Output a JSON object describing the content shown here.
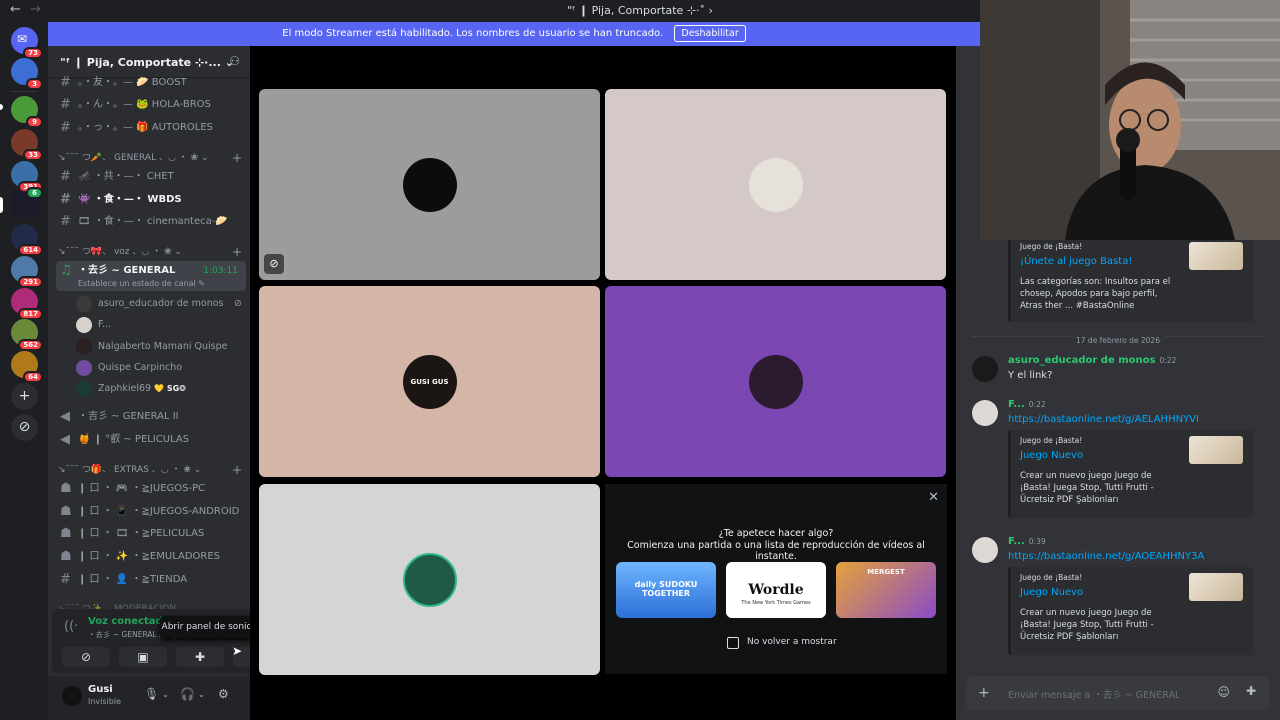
{
  "window": {
    "title": "\"ᶠ ❙ Pija, Comportate ⊹·˚ ›",
    "back": "←",
    "forward": "→"
  },
  "banner": {
    "text": "El modo Streamer está habilitado. Los nombres de usuario se han truncado.",
    "button": "Deshabilitar",
    "color": "#5865f2"
  },
  "server_rail": {
    "badges": [
      "73",
      "3",
      "9",
      "33",
      "391",
      "6",
      "614",
      "291",
      "817",
      "562",
      "64"
    ],
    "add_icon": "plus-icon",
    "discover_icon": "compass-icon"
  },
  "guild": {
    "name": "\"ᶠ ❙ Pija, Comportate ⊹·...",
    "chevron": "⌄"
  },
  "channels": {
    "boost": "。・友・。— 🥟 BOOST",
    "hola_bros": "。・ん・。— 🐸 HOLA-BROS",
    "autoroles": "。・っ・。— 🎁 AUTOROLES",
    "cat_general": "↘˘˘˘ つ🥕、 GENERAL 、◡ ・ ❀ ⌄",
    "chet": "🦟 ・共・—・ CHET",
    "wbds": "👾 ・食・—・ WBDS",
    "cinemanteca": "🎞 ・食・—・ cinemanteca-🥟",
    "cat_voz": "↘˘˘˘ つ🎀、 voz 、◡ ・ ❀ ⌄",
    "voice_general": "・去彡 ~ GENERAL",
    "voice_timer": "1:03:11",
    "voice_status_hint": "Establece un estado de canal ✎",
    "general_ii": "・吉彡 ~ GENERAL II",
    "peliculas": "🍯 ❙ °叡 ~ PELICULAS",
    "cat_extras": "↘˘˘˘ つ🎁、 EXTRAS 、◡ ・ ❀ ⌄",
    "juegos_pc": "❙ 口 ・ 🎮 ・≧JUEGOS-PC",
    "juegos_android": "❙ 口 ・ 📱 ・≧JUEGOS-ANDROID",
    "peliculas2": "❙ 口 ・ 🎞 ・≧PELICULAS",
    "emuladores": "❙ 口 ・ ✨ ・≧EMULADORES",
    "tienda": "❙ 口 ・ 👤 ・≧TIENDA",
    "cat_moderation": "↘˘˘˘ つ✨、 MODERACION"
  },
  "voice_members": [
    {
      "name": "asuro_educador de monos",
      "color": "#3a3a3a"
    },
    {
      "name": "F...",
      "color": "#d8d3cf"
    },
    {
      "name": "Nalgaberto Mamani Quispe",
      "color": "#2b2020"
    },
    {
      "name": "Quispe Carpincho",
      "color": "#6f4da1"
    },
    {
      "name": "Zaphkiel69",
      "color": "#1d3b36",
      "tag": "💛 SG❂"
    }
  ],
  "voice_panel": {
    "connected": "Voz conectada",
    "location": "・去彡 ~ GENERAL / \"ᶠ ❙ Pija, Comportate",
    "tooltip": "Abrir panel de sonidos"
  },
  "user": {
    "name": "Gusi",
    "status": "Invisible"
  },
  "stage": {
    "tiles": [
      {
        "bg": "#9c9c9c",
        "avatar": "#0c0c0c"
      },
      {
        "bg": "#d4c9c6",
        "avatar": "#e7e1dc"
      },
      {
        "bg": "#d4b5a7",
        "avatar": "#1b1613"
      },
      {
        "bg": "#7a47b3",
        "avatar": "#2c1a2e"
      },
      {
        "bg": "#d5d5d5",
        "avatar": "#1f5a48"
      }
    ],
    "gusi_logo": "GUSI GUS"
  },
  "activity": {
    "title": "¿Te apetece hacer algo?",
    "subtitle": "Comienza una partida o una lista de reproducción de vídeos al instante.",
    "games": [
      "daily SUDOKU TOGETHER",
      "Wordle",
      "MERGEST"
    ],
    "wordle_sub": "The New York Times Games",
    "checkbox": "No volver a mostrar"
  },
  "chat": {
    "embed1": {
      "provider": "Juego de ¡Basta!",
      "title": "¡Únete al juego Basta!",
      "desc": "Las categorías son: Insultos para el chosep, Apodos para bajo perfil, Atras ther ... #BastaOnline"
    },
    "date": "17 de febrero de 2026",
    "msg1": {
      "name": "asuro_educador de monos",
      "time": "0:22",
      "text": "Y el link?"
    },
    "msg2": {
      "name": "F...",
      "time": "0:22",
      "link": "https://bastaonline.net/g/AELAHHNYVI"
    },
    "embed2": {
      "provider": "Juego de ¡Basta!",
      "title": "Juego Nuevo",
      "desc": "Crear un nuevo juego Juego de ¡Basta! Juega Stop, Tutti Frutti - Ücretsiz PDF Şablonları"
    },
    "msg3": {
      "name": "F...",
      "time": "0:39",
      "link": "https://bastaonline.net/g/AOEAHHNY3A"
    },
    "embed3": {
      "provider": "Juego de ¡Basta!",
      "title": "Juego Nuevo",
      "desc": "Crear un nuevo juego Juego de ¡Basta! Juega Stop, Tutti Frutti - Ücretsiz PDF Şablonları"
    },
    "input_placeholder": "Enviar mensaje a ・去彡 ~ GENERAL"
  }
}
